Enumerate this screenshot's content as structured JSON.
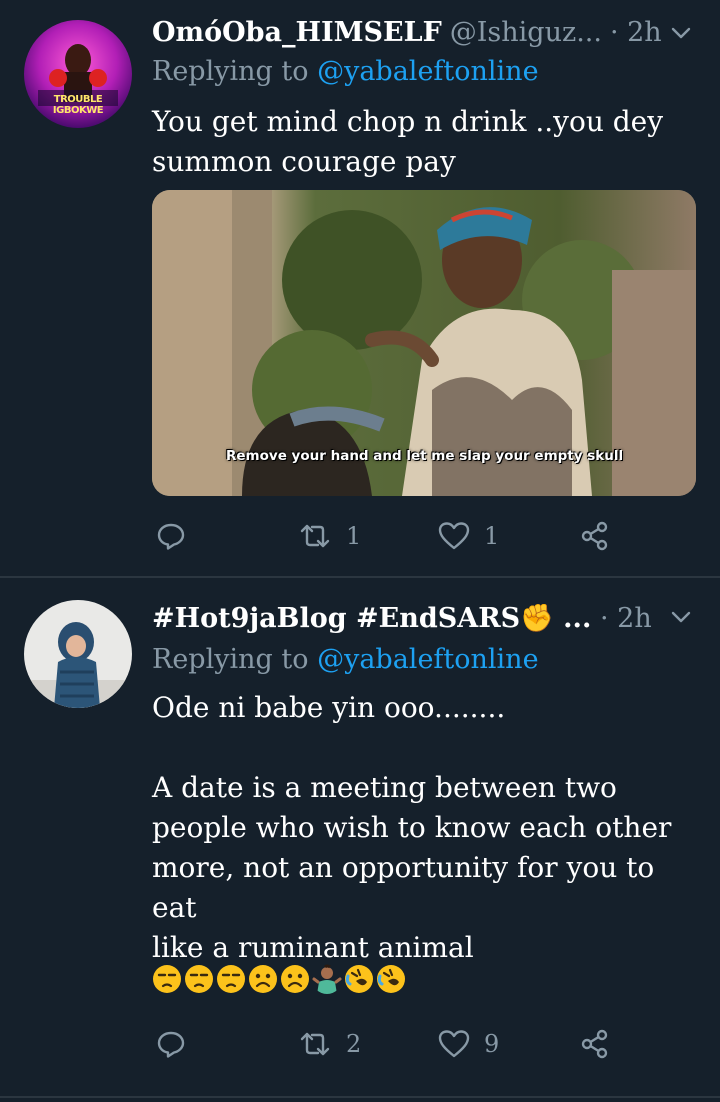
{
  "tweets": [
    {
      "name": "OmóOba_HIMSELF",
      "handle": "@Ishiguz...",
      "time": "· 2h",
      "replying_prefix": "Replying to",
      "replying_to": "@yabaleftonline",
      "text_lines": [
        "You get mind chop n drink ..you dey",
        "summon courage pay"
      ],
      "media_caption": "Remove your hand and let me slap your empty skull",
      "avatar_text": "TROUBLE IGBOKWE",
      "actions": {
        "replies": "",
        "retweets": "1",
        "likes": "1"
      }
    },
    {
      "name": "#Hot9jaBlog #EndSARS✊ ...",
      "handle": "",
      "time": "· 2h",
      "replying_prefix": "Replying to",
      "replying_to": "@yabaleftonline",
      "text_lines": [
        "Ode ni babe yin ooo........",
        "",
        "A date is a meeting between two",
        "people who wish to know each other",
        "more, not an opportunity for you to eat",
        "like a ruminant animal"
      ],
      "emojis": [
        "unamused",
        "unamused",
        "unamused",
        "frowning",
        "frowning",
        "person-shrugging",
        "rolling-laughing",
        "rolling-laughing"
      ],
      "actions": {
        "replies": "",
        "retweets": "2",
        "likes": "9"
      }
    }
  ],
  "colors": {
    "background": "#15202b",
    "secondary_text": "#8899a6",
    "link": "#1da1f2",
    "divider": "#2b3640"
  }
}
